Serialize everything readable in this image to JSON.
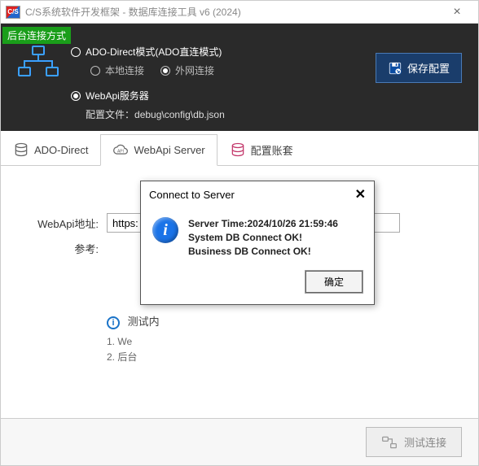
{
  "window": {
    "logo_text": "C/S",
    "title": "C/S系统软件开发框架 - 数据库连接工具 v6 (2024)",
    "close": "×"
  },
  "top": {
    "tag": "后台连接方式",
    "radio_ado": "ADO-Direct模式(ADO直连模式)",
    "radio_local": "本地连接",
    "radio_external": "外网连接",
    "radio_webapi": "WebApi服务器",
    "config_label": "配置文件：",
    "config_path": "debug\\config\\db.json",
    "save_btn": "保存配置"
  },
  "tabs": {
    "ado": "ADO-Direct",
    "webapi": "WebApi Server",
    "account": "配置账套"
  },
  "form": {
    "url_label": "WebApi地址:",
    "url_value": "https:",
    "ref_label": "参考:"
  },
  "notice": {
    "title": "测试内",
    "line1": "1. We",
    "line2": "2. 后台"
  },
  "footer": {
    "test_btn": "测试连接"
  },
  "dialog": {
    "title": "Connect to Server",
    "close": "✕",
    "line1": "Server Time:2024/10/26 21:59:46",
    "line2": "System DB Connect OK!",
    "line3": "Business DB Connect OK!",
    "ok": "确定"
  }
}
